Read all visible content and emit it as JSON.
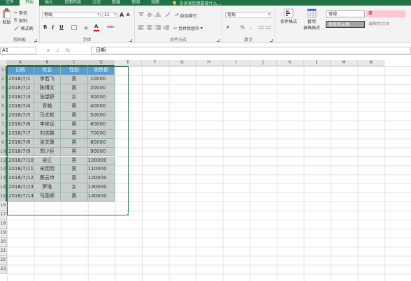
{
  "ribbon_tabs": [
    {
      "label": "文件",
      "active": false
    },
    {
      "label": "开始",
      "active": true
    },
    {
      "label": "插入",
      "active": false
    },
    {
      "label": "页面布局",
      "active": false
    },
    {
      "label": "公式",
      "active": false
    },
    {
      "label": "数据",
      "active": false
    },
    {
      "label": "审阅",
      "active": false
    },
    {
      "label": "视图",
      "active": false
    }
  ],
  "tell_me": "告诉我您想要做什么...",
  "clipboard": {
    "paste": "粘贴",
    "cut": "剪切",
    "copy": "复制",
    "format_painter": "格式刷",
    "group": "剪贴板"
  },
  "font": {
    "name": "等线",
    "size": "11",
    "grow": "A",
    "shrink": "A",
    "bold": "B",
    "italic": "I",
    "underline": "U",
    "group": "字体",
    "ext_char": "wén"
  },
  "alignment": {
    "wrap": "自动换行",
    "merge": "合并后居中",
    "group": "对齐方式"
  },
  "number": {
    "format": "常规",
    "currency": "¥",
    "percent": "%",
    "comma": ",",
    "group": "数字"
  },
  "styles": {
    "conditional": "条件格式",
    "table": "套用",
    "table2": "表格格式",
    "normal": "常规",
    "bad": "差",
    "check": "检查单元格",
    "explain": "解释性文本"
  },
  "colors": {
    "accent": "#217346",
    "header_fill": "#5b9bd5",
    "data_fill": "#c9cfcc",
    "bad_fill": "#ffc7ce",
    "check_fill": "#a5a5a5"
  },
  "formula_bar": {
    "name_box": "A1",
    "cancel": "✕",
    "enter": "✓",
    "fx": "fx",
    "value": "日期"
  },
  "columns": [
    "A",
    "B",
    "C",
    "D",
    "E",
    "F",
    "G",
    "H",
    "I",
    "J",
    "K",
    "L",
    "M",
    "N"
  ],
  "rows": [
    "1",
    "2",
    "3",
    "4",
    "5",
    "6",
    "7",
    "8",
    "9",
    "10",
    "11",
    "12",
    "13",
    "14",
    "15",
    "16",
    "17",
    "18",
    "19",
    "20",
    "21",
    "22",
    "23"
  ],
  "table": {
    "headers": [
      "日期",
      "姓名",
      "性别",
      "销售额"
    ],
    "rows": [
      [
        "2018/7/1",
        "李若飞",
        "男",
        "10000"
      ],
      [
        "2018/7/2",
        "陈博文",
        "男",
        "20000"
      ],
      [
        "2018/7/3",
        "张望舒",
        "女",
        "30000"
      ],
      [
        "2018/7/4",
        "青翰",
        "男",
        "40000"
      ],
      [
        "2018/7/5",
        "马文彬",
        "男",
        "50000"
      ],
      [
        "2018/7/6",
        "李修远",
        "男",
        "60000"
      ],
      [
        "2018/7/7",
        "刘志鹏",
        "男",
        "70000"
      ],
      [
        "2018/7/8",
        "张文康",
        "男",
        "80000"
      ],
      [
        "2018/7/9",
        "郑少臣",
        "男",
        "90000"
      ],
      [
        "2018/7/10",
        "梁正",
        "男",
        "100000"
      ],
      [
        "2018/7/11",
        "宋宪明",
        "男",
        "110000"
      ],
      [
        "2018/7/12",
        "蔡云申",
        "男",
        "120000"
      ],
      [
        "2018/7/13",
        "罗逸",
        "女",
        "130000"
      ],
      [
        "2018/7/14",
        "马圣卿",
        "男",
        "140000"
      ]
    ]
  }
}
